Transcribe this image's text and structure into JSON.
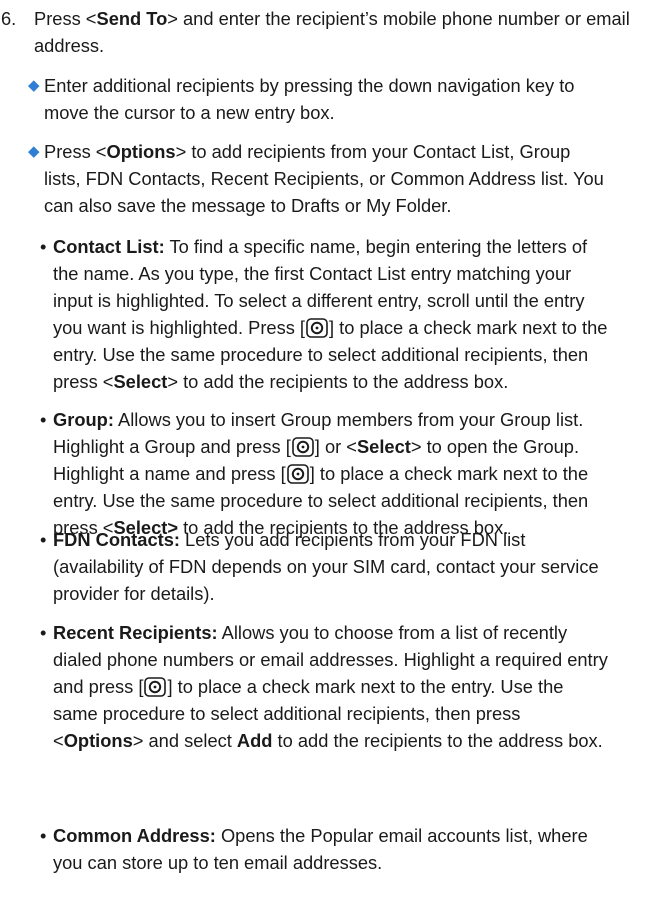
{
  "step": {
    "number": "6.",
    "parts": [
      "Press <",
      "Send To",
      "> and enter the recipient’s mobile phone number or email address."
    ]
  },
  "diamonds": [
    {
      "text": "Enter additional recipients by pressing the down navigation key to move the cursor to a new entry box."
    },
    {
      "parts": [
        "Press <",
        "Options",
        "> to add recipients from your Contact List, Group lists, FDN Contacts, Recent Recipients, or Common Address list. You can also save the message to Drafts or My Folder."
      ]
    }
  ],
  "bullets": {
    "contact": {
      "title": "Contact List:",
      "t1": " To find a specific name, begin entering the letters of the name. As you type, the first Contact List entry matching your input is highlighted. To select a different entry, scroll until the entry you want is highlighted. Press [",
      "t2": "] to place a check mark next to the entry. Use the same procedure to select additional recipients, then press <",
      "t3": "Select",
      "t4": "> to add the recipients to the address box."
    },
    "group": {
      "title": "Group:",
      "t1": " Allows you to insert Group members from your Group list. Highlight a Group and press [",
      "t2": "] or <",
      "t3": "Select",
      "t4": "> to open the Group. Highlight a name and press [",
      "t5": "] to place a check mark next to the entry. Use the same procedure to select additional recipients, then press <",
      "t6": "Select>",
      "t7": " to add the recipients to the address box."
    },
    "fdn": {
      "title": "FDN Contacts:",
      "t1": " Lets you add recipients from your FDN list (availability of FDN depends on your SIM card, contact your service provider for details)."
    },
    "recent": {
      "title": "Recent Recipients:",
      "t1": " Allows you to choose from a list of recently dialed phone numbers or email addresses. Highlight a required entry and press [",
      "t2": "] to place a check mark next to the entry. Use the same procedure to select additional recipients, then press <",
      "t3": "Options",
      "t4": "> and select ",
      "t5": "Add",
      "t6": " to add the recipients to the address box."
    },
    "common": {
      "title": "Common Address:",
      "t1": " Opens the Popular email accounts list, where you can store up to ten email addresses."
    }
  },
  "icons": {
    "bullet_diamond": "◆",
    "bullet_dot": "•",
    "select_key": "center-select-key-icon"
  },
  "colors": {
    "diamond": "#2f7fd4",
    "text": "#1a1a1a"
  }
}
